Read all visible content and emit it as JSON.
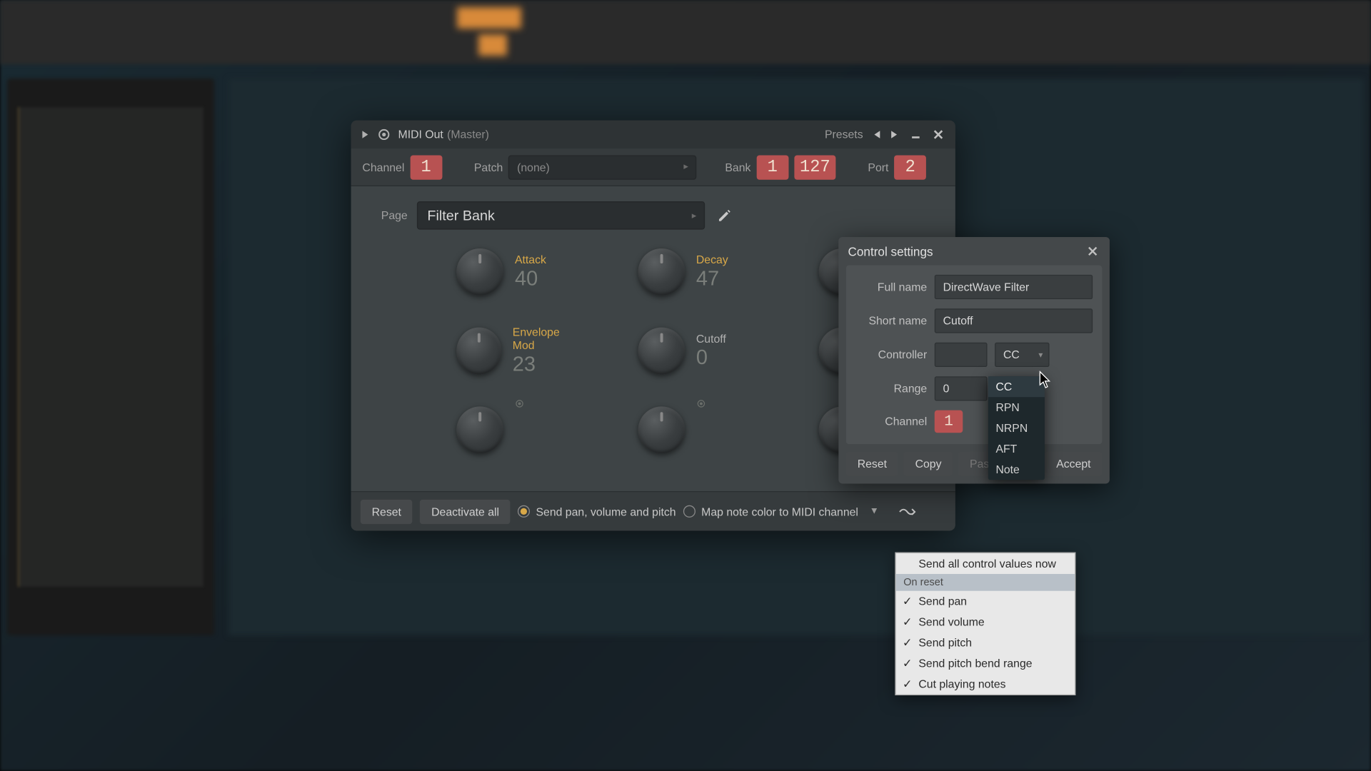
{
  "window": {
    "title": "MIDI Out",
    "subtitle": "(Master)",
    "presets_label": "Presets"
  },
  "toprow": {
    "channel_label": "Channel",
    "channel_value": "1",
    "patch_label": "Patch",
    "patch_value": "(none)",
    "bank_label": "Bank",
    "bank_value1": "1",
    "bank_value2": "127",
    "port_label": "Port",
    "port_value": "2"
  },
  "page": {
    "label": "Page",
    "value": "Filter Bank"
  },
  "knobs": [
    [
      {
        "label": "Attack",
        "value": "40",
        "active": true
      },
      {
        "label": "Decay",
        "value": "47",
        "active": true
      },
      {
        "label": "",
        "value": "",
        "active": false
      }
    ],
    [
      {
        "label": "Envelope Mod",
        "value": "23",
        "active": true
      },
      {
        "label": "Cutoff",
        "value": "0",
        "active": false
      },
      {
        "label": "",
        "value": "",
        "active": false
      }
    ],
    [
      {
        "label": "",
        "value": "",
        "active": false,
        "gear": true
      },
      {
        "label": "",
        "value": "",
        "active": false,
        "gear": true
      },
      {
        "label": "",
        "value": "",
        "active": false
      }
    ]
  ],
  "footer": {
    "reset": "Reset",
    "deactivate": "Deactivate all",
    "send_pvp": "Send pan, volume and pitch",
    "map_note": "Map note color to MIDI channel"
  },
  "ctrl": {
    "title": "Control settings",
    "fullname_label": "Full name",
    "fullname_value": "DirectWave Filter",
    "shortname_label": "Short name",
    "shortname_value": "Cutoff",
    "controller_label": "Controller",
    "controller_num": "",
    "controller_type": "CC",
    "range_label": "Range",
    "range_value": "0",
    "channel_label": "Channel",
    "channel_value": "1",
    "reset": "Reset",
    "copy": "Copy",
    "paste": "Paste",
    "accept": "Accept"
  },
  "dd": {
    "items": [
      "CC",
      "RPN",
      "NRPN",
      "AFT",
      "Note"
    ],
    "selected": "CC"
  },
  "ctx": {
    "top": "Send all control values now",
    "header": "On reset",
    "items": [
      "Send pan",
      "Send volume",
      "Send pitch",
      "Send pitch bend range",
      "Cut playing notes"
    ]
  }
}
